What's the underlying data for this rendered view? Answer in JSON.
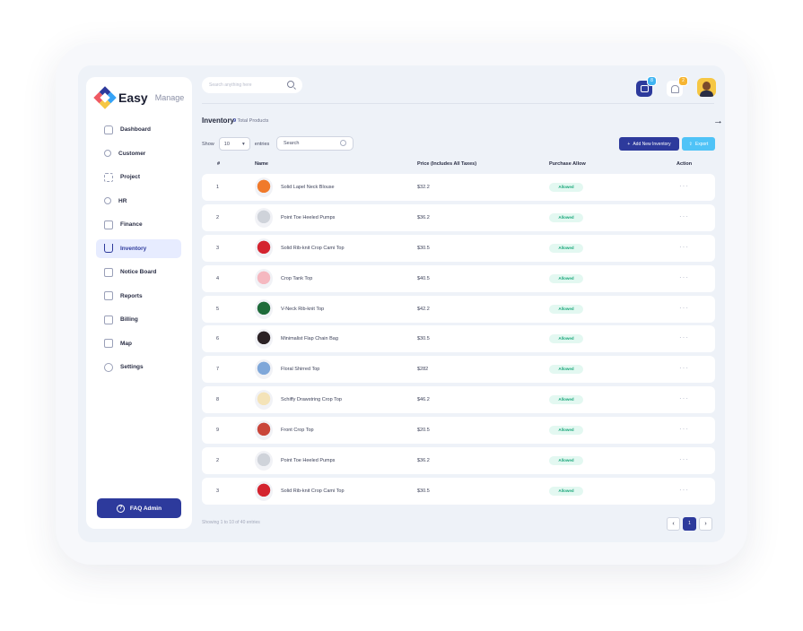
{
  "app": {
    "logo_text": "Easy",
    "logo_sub": "Manage"
  },
  "search": {
    "placeholder": "Search anything here"
  },
  "badges": {
    "messages": "8",
    "notifications": "2"
  },
  "sidebar": {
    "items": [
      {
        "label": "Dashboard",
        "icon": "home-icon"
      },
      {
        "label": "Customer",
        "icon": "user-group-icon"
      },
      {
        "label": "Project",
        "icon": "grid-icon"
      },
      {
        "label": "HR",
        "icon": "user-icon"
      },
      {
        "label": "Finance",
        "icon": "wallet-icon"
      },
      {
        "label": "Inventory",
        "icon": "cart-icon",
        "active": true
      },
      {
        "label": "Notice Board",
        "icon": "clipboard-icon"
      },
      {
        "label": "Reports",
        "icon": "chart-icon"
      },
      {
        "label": "Billing",
        "icon": "receipt-icon"
      },
      {
        "label": "Map",
        "icon": "map-icon"
      },
      {
        "label": "Settings",
        "icon": "gear-icon"
      }
    ],
    "faq_label": "FAQ Admin"
  },
  "main": {
    "title": "Inventory",
    "count_number": "9",
    "count_label": "Total Products",
    "show_label": "Show",
    "entries_value": "10",
    "entries_label": "entries",
    "table_search_placeholder": "Search",
    "add_button": "Add New Inventory",
    "export_button": "Export",
    "columns": [
      "#",
      "Name",
      "Price (Includes All Taxes)",
      "Purchase Allow",
      "Action"
    ],
    "rows": [
      {
        "num": "1",
        "name": "Solid Lapel Neck Blouse",
        "price": "$32.2",
        "allow": "Allowed",
        "img_color": "#f07a2b"
      },
      {
        "num": "2",
        "name": "Point Toe Heeled Pumps",
        "price": "$36.2",
        "allow": "Allowed",
        "img_color": "#cfd3da"
      },
      {
        "num": "3",
        "name": "Solid Rib-knit Crop Cami Top",
        "price": "$30.5",
        "allow": "Allowed",
        "img_color": "#d4242f"
      },
      {
        "num": "4",
        "name": "Crop Tank Top",
        "price": "$40.5",
        "allow": "Allowed",
        "img_color": "#f5b8c0"
      },
      {
        "num": "5",
        "name": "V-Neck Rib-knit Top",
        "price": "$42.2",
        "allow": "Allowed",
        "img_color": "#1f6b3a"
      },
      {
        "num": "6",
        "name": "Minimalist Flap Chain Bag",
        "price": "$30.5",
        "allow": "Allowed",
        "img_color": "#2b2225"
      },
      {
        "num": "7",
        "name": "Floral Shirred Top",
        "price": "$282",
        "allow": "Allowed",
        "img_color": "#7fa7d9"
      },
      {
        "num": "8",
        "name": "Schiffy Drawstring Crop Top",
        "price": "$46.2",
        "allow": "Allowed",
        "img_color": "#f4e3b8"
      },
      {
        "num": "9",
        "name": "Front Crop Top",
        "price": "$20.5",
        "allow": "Allowed",
        "img_color": "#c9463a"
      },
      {
        "num": "2",
        "name": "Point Toe Heeled Pumps",
        "price": "$36.2",
        "allow": "Allowed",
        "img_color": "#cfd3da"
      },
      {
        "num": "3",
        "name": "Solid Rib-knit Crop Cami Top",
        "price": "$30.5",
        "allow": "Allowed",
        "img_color": "#d4242f"
      }
    ],
    "action_glyph": "···",
    "showing_text": "Showing 1 to 10 of 40 entries",
    "current_page": "1"
  },
  "colors": {
    "primary": "#2d3a9c",
    "accent": "#4fc3f7",
    "allowed_bg": "#e3f8f1",
    "allowed_text": "#1aa77a"
  }
}
